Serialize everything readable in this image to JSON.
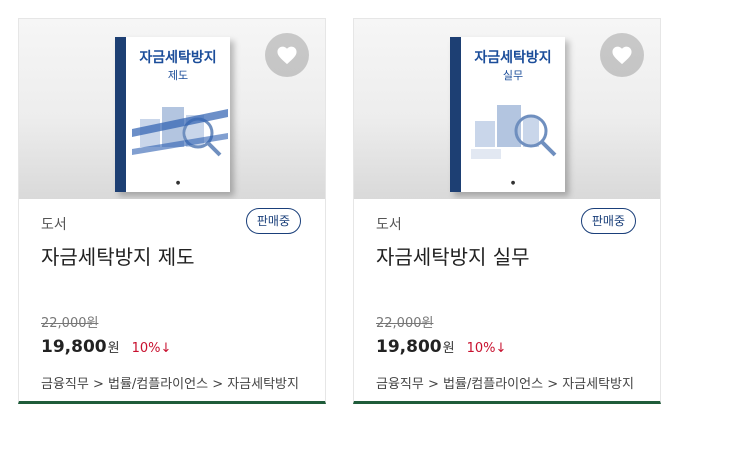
{
  "products": [
    {
      "category": "도서",
      "status": "판매중",
      "title": "자금세탁방지 제도",
      "original_price": "22,000원",
      "sale_price": "19,800",
      "currency": "원",
      "discount": "10%↓",
      "breadcrumb": "금융직무 > 법률/컴플라이언스 > 자금세탁방지",
      "cover": {
        "title": "자금세탁방지",
        "subtitle": "제도"
      }
    },
    {
      "category": "도서",
      "status": "판매중",
      "title": "자금세탁방지 실무",
      "original_price": "22,000원",
      "sale_price": "19,800",
      "currency": "원",
      "discount": "10%↓",
      "breadcrumb": "금융직무 > 법률/컴플라이언스 > 자금세탁방지",
      "cover": {
        "title": "자금세탁방지",
        "subtitle": "실무"
      }
    }
  ],
  "colors": {
    "accent": "#1a3f7a",
    "discount": "#c8102e",
    "bottom_border": "#1f5c3a"
  },
  "icons": {
    "wishlist": "heart-icon"
  }
}
